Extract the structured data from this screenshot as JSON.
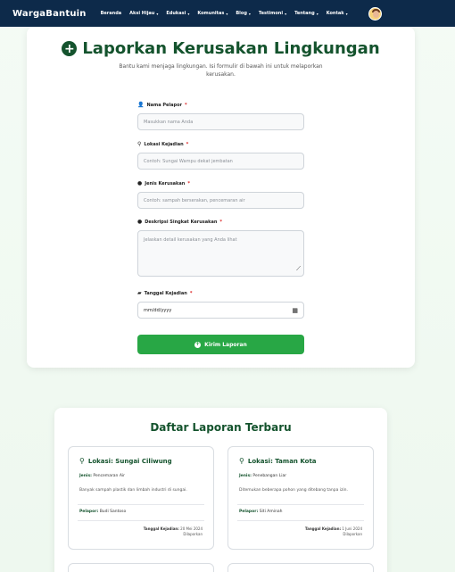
{
  "navbar": {
    "brand": "WargaBantuin",
    "items": [
      {
        "label": "Beranda",
        "dropdown": false
      },
      {
        "label": "Aksi Hijau",
        "dropdown": true
      },
      {
        "label": "Edukasi",
        "dropdown": true
      },
      {
        "label": "Komunitas",
        "dropdown": true
      },
      {
        "label": "Blog",
        "dropdown": true
      },
      {
        "label": "Testimoni",
        "dropdown": true
      },
      {
        "label": "Tentang",
        "dropdown": true
      },
      {
        "label": "Kontak",
        "dropdown": true
      }
    ],
    "caret": "▾"
  },
  "form": {
    "title": "Laporkan Kerusakan Lingkungan",
    "subtitle": "Bantu kami menjaga lingkungan. Isi formulir di bawah ini untuk melaporkan kerusakan.",
    "required_mark": "*",
    "fields": {
      "name": {
        "label": "Nama Pelapor",
        "placeholder": "Masukkan nama Anda"
      },
      "location": {
        "label": "Lokasi Kejadian",
        "placeholder": "Contoh: Sungai Wampu dekat jembatan"
      },
      "type": {
        "label": "Jenis Kerusakan",
        "placeholder": "Contoh: sampah berserakan, pencemaran air"
      },
      "description": {
        "label": "Deskripsi Singkat Kerusakan",
        "placeholder": "Jelaskan detail kerusakan yang Anda lihat"
      },
      "date": {
        "label": "Tanggal Kejadian",
        "value": "mm/dd/yyyy"
      }
    },
    "submit_label": "Kirim Laporan"
  },
  "reports": {
    "title": "Daftar Laporan Terbaru",
    "items": [
      {
        "location": "Lokasi: Sungai Ciliwung",
        "type_label": "Jenis:",
        "type": "Pencemaran Air",
        "description": "Banyak sampah plastik dan limbah industri di sungai.",
        "reporter_label": "Pelapor:",
        "reporter": "Budi Santoso",
        "date_label": "Tanggal Kejadian:",
        "date": "20 Mei 2024",
        "status": "Dilaporkan"
      },
      {
        "location": "Lokasi: Taman Kota",
        "type_label": "Jenis:",
        "type": "Penebangan Liar",
        "description": "Ditemukan beberapa pohon yang ditebang tanpa izin.",
        "reporter_label": "Pelapor:",
        "reporter": "Siti Aminah",
        "date_label": "Tanggal Kejadian:",
        "date": "1 Juni 2024",
        "status": "Dilaporkan"
      }
    ]
  }
}
